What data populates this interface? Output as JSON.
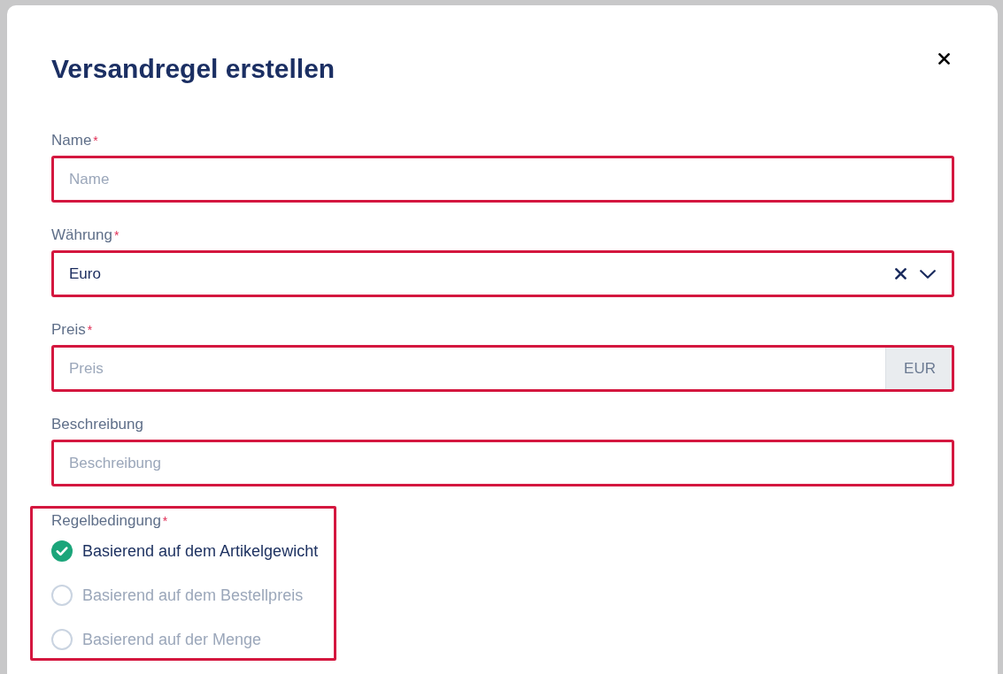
{
  "dialog": {
    "title": "Versandregel erstellen"
  },
  "fields": [
    {
      "kind": "text",
      "label": "Name",
      "required_mark": "*",
      "placeholder": "Name",
      "highlighted": true
    },
    {
      "kind": "select",
      "label": "Währung",
      "required_mark": "*",
      "value": "Euro",
      "highlighted": true
    },
    {
      "kind": "addon",
      "label": "Preis",
      "required_mark": "*",
      "placeholder": "Preis",
      "addon": "EUR",
      "highlighted": true
    },
    {
      "kind": "text",
      "label": "Beschreibung",
      "placeholder": "Beschreibung",
      "highlighted": true
    }
  ],
  "rule_condition": {
    "label": "Regelbedingung",
    "required_mark": "*",
    "highlighted": true,
    "options": [
      {
        "label": "Basierend auf dem Artikelgewicht",
        "selected": true
      },
      {
        "label": "Basierend auf dem Bestellpreis",
        "selected": false
      },
      {
        "label": "Basierend auf der Menge",
        "selected": false
      }
    ]
  }
}
